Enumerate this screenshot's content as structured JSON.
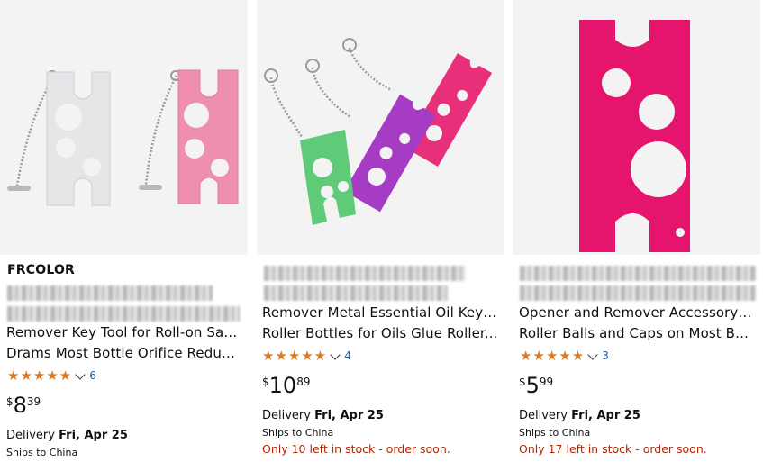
{
  "products": [
    {
      "brand": "FRCOLOR",
      "title_line_1": "Remover Key Tool for Roll-on Sample",
      "title_line_2": "Drams Most Bottle Orifice Reducers...",
      "stars": "★★★★★",
      "rating": 5,
      "review_count": "6",
      "price_symbol": "$",
      "price_whole": "8",
      "price_fraction": "39",
      "delivery_label": "Delivery",
      "delivery_date": "Fri, Apr 25",
      "ships_to": "Ships to China",
      "stock_note": ""
    },
    {
      "title_line_1": "Remover Metal Essential Oil Key Tool",
      "title_line_2": "Roller Bottles for Oils Glue Roller...",
      "stars": "★★★★★",
      "rating": 5,
      "review_count": "4",
      "price_symbol": "$",
      "price_whole": "10",
      "price_fraction": "89",
      "delivery_label": "Delivery",
      "delivery_date": "Fri, Apr 25",
      "ships_to": "Ships to China",
      "stock_note": "Only 10 left in stock - order soon."
    },
    {
      "title_line_1": "Opener and Remover Accessory for",
      "title_line_2": "Roller Balls and Caps on Most Bottl...",
      "stars": "★★★★★",
      "rating": 5,
      "review_count": "3",
      "price_symbol": "$",
      "price_whole": "5",
      "price_fraction": "99",
      "delivery_label": "Delivery",
      "delivery_date": "Fri, Apr 25",
      "ships_to": "Ships to China",
      "stock_note": "Only 17 left in stock - order soon."
    }
  ],
  "colors": {
    "star": "#DE7921",
    "link": "#2162A1",
    "stock_warning": "#B12704",
    "image_background": "#F3F3F3",
    "tool_silver": "#E6E6E9",
    "tool_pink": "#EE8FB0",
    "tool_green": "#5FCB79",
    "tool_purple": "#A63CC4",
    "tool_magenta": "#E8307A",
    "tool_hot_pink": "#E5156E"
  }
}
